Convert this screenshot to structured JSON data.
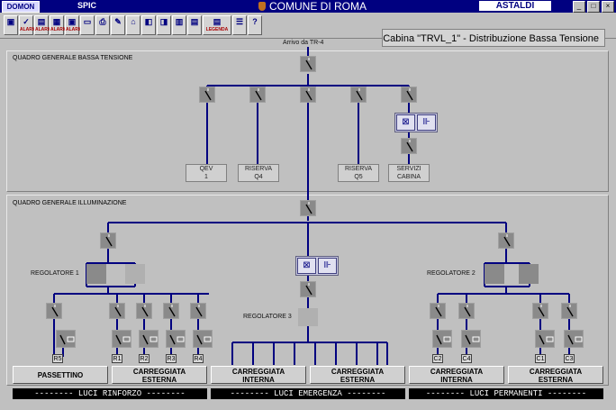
{
  "titlebar": {
    "left_logo": "DOMON",
    "app_name": "SPIC",
    "city": "COMUNE DI ROMA",
    "brand": "ASTALDI",
    "window_buttons": [
      "_",
      "□",
      "×"
    ]
  },
  "toolbar": {
    "tools": [
      {
        "name": "monitor-tool",
        "icon": "▣",
        "text": ""
      },
      {
        "name": "alarm-tool-1",
        "icon": "✓",
        "text": "ALARM"
      },
      {
        "name": "alarm-tool-2",
        "icon": "▤",
        "text": "ALARM"
      },
      {
        "name": "alarm-tool-3",
        "icon": "▦",
        "text": "ALARM"
      },
      {
        "name": "alarm-tool-4",
        "icon": "▣",
        "text": "ALARM"
      },
      {
        "name": "folder-tool",
        "icon": "▭",
        "text": ""
      },
      {
        "name": "print-tool",
        "icon": "⎙",
        "text": ""
      },
      {
        "name": "edit-tool",
        "icon": "✎",
        "text": ""
      },
      {
        "name": "tool-9",
        "icon": "⌂",
        "text": ""
      },
      {
        "name": "tool-10",
        "icon": "◧",
        "text": ""
      },
      {
        "name": "tool-11",
        "icon": "◨",
        "text": ""
      },
      {
        "name": "tool-12",
        "icon": "▥",
        "text": ""
      },
      {
        "name": "tool-13",
        "icon": "▤",
        "text": ""
      },
      {
        "name": "legend-tool",
        "icon": "▤",
        "text": "LEGENDA"
      },
      {
        "name": "list-tool",
        "icon": "☰",
        "text": ""
      },
      {
        "name": "help-tool",
        "icon": "?",
        "text": ""
      }
    ],
    "cabin_title": "Cabina \"TRVL_1\" - Distribuzione Bassa Tensione"
  },
  "panels": {
    "low_voltage": "QUADRO GENERALE BASSA TENSIONE",
    "lighting": "QUADRO GENERALE ILLUMINAZIONE"
  },
  "incoming": "Arrivo da TR-4",
  "feeders_top": [
    {
      "line1": "QEV",
      "line2": "1"
    },
    {
      "line1": "RISERVA",
      "line2": "Q4"
    },
    {
      "line1": "RISERVA",
      "line2": "Q5"
    },
    {
      "line1": "SERVIZI",
      "line2": "CABINA"
    }
  ],
  "regulators": {
    "r1": "REGOLATORE 1",
    "r2": "REGOLATORE 2",
    "r3": "REGOLATORE 3"
  },
  "circuit_tags": [
    "R5",
    "R1",
    "R2",
    "R3",
    "R4",
    "C2",
    "C4",
    "C1",
    "C3"
  ],
  "buttons": [
    {
      "line1": "PASSETTINO",
      "line2": ""
    },
    {
      "line1": "CARREGGIATA",
      "line2": "ESTERNA"
    },
    {
      "line1": "CARREGGIATA",
      "line2": "INTERNA"
    },
    {
      "line1": "CARREGGIATA",
      "line2": "ESTERNA"
    },
    {
      "line1": "CARREGGIATA",
      "line2": "INTERNA"
    },
    {
      "line1": "CARREGGIATA",
      "line2": "ESTERNA"
    }
  ],
  "bands": {
    "reinforcement": "-------- LUCI RINFORZO --------",
    "emergency": "-------- LUCI EMERGENZA --------",
    "permanent": "-------- LUCI PERMANENTI --------"
  },
  "colors": {
    "bus": "#000080",
    "switch": "#8a8a8a",
    "background": "#c0c0c0",
    "titlebar": "#000080"
  }
}
